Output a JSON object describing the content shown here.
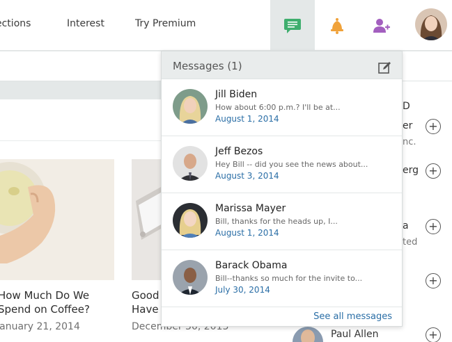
{
  "nav": {
    "links": [
      "ections",
      "Interest",
      "Try Premium"
    ]
  },
  "colors": {
    "accent_green": "#3fae6e",
    "accent_orange": "#f0a23a",
    "accent_purple": "#a35fbf",
    "link_blue": "#2a6ea6"
  },
  "icons": {
    "messages": "chat-bubble-icon",
    "notifications": "bell-icon",
    "add_contact": "add-user-icon",
    "compose": "compose-icon",
    "follow": "plus-circle-icon"
  },
  "messages": {
    "title": "Messages (1)",
    "items": [
      {
        "name": "Jill Biden",
        "preview": "How about 6:00 p.m.? I'll be at...",
        "date": "August 1, 2014"
      },
      {
        "name": "Jeff Bezos",
        "preview": "Hey Bill -- did you see the news about...",
        "date": "August 3, 2014"
      },
      {
        "name": "Marissa Mayer",
        "preview": "Bill, thanks for the heads up, I...",
        "date": "August 1, 2014"
      },
      {
        "name": "Barack Obama",
        "preview": "Bill--thanks so much for the invite to...",
        "date": "July 30, 2014"
      }
    ],
    "see_all": "See all messages"
  },
  "articles": [
    {
      "title_line1": "How Much Do We",
      "title_line2": "Spend on Coffee?",
      "date": "January 21, 2014"
    },
    {
      "title_line1": "Good",
      "title_line2": "Have",
      "date": "December 30, 2013"
    }
  ],
  "right_col": {
    "texts": [
      "D",
      "er",
      "nc.",
      "erg",
      "a",
      "ted"
    ],
    "person": "Paul Allen"
  }
}
